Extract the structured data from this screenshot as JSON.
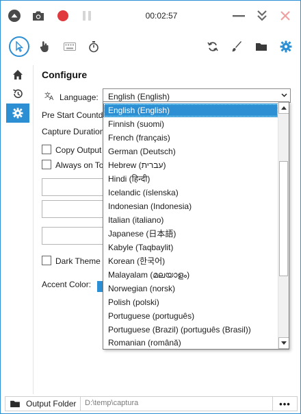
{
  "titlebar": {
    "timer": "00:02:57"
  },
  "configure": {
    "heading": "Configure",
    "language_label": "Language:",
    "language_selected": "English (English)",
    "pre_start_label": "Pre Start Countdo",
    "capture_duration_label": "Capture Duration",
    "copy_output_label": "Copy Output",
    "always_on_top_label": "Always on To",
    "dark_theme_label": "Dark Theme",
    "accent_color_label": "Accent Color:"
  },
  "language_list": {
    "items": [
      "English (English)",
      "Finnish (suomi)",
      "French (français)",
      "German (Deutsch)",
      "Hebrew (עברית)",
      "Hindi (हिन्दी)",
      "Icelandic (íslenska)",
      "Indonesian (Indonesia)",
      "Italian (italiano)",
      "Japanese (日本語)",
      "Kabyle (Taqbaylit)",
      "Korean (한국어)",
      "Malayalam (മലയാളം)",
      "Norwegian (norsk)",
      "Polish (polski)",
      "Portuguese (português)",
      "Portuguese (Brazil) (português (Brasil))",
      "Romanian (română)"
    ]
  },
  "bottombar": {
    "output_folder_label": "Output Folder",
    "path": "D:\\temp\\captura",
    "more_label": "•••"
  },
  "colors": {
    "accent": "#2d8fd3",
    "record": "#e0393e",
    "close": "#f0a0a0"
  }
}
